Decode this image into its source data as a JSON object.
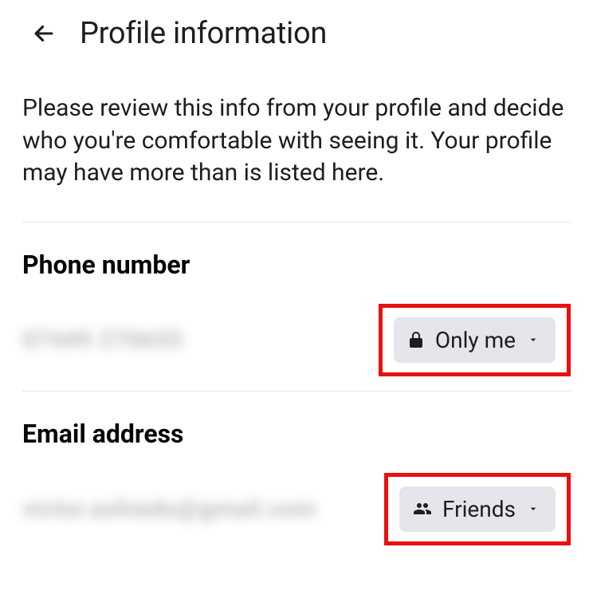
{
  "header": {
    "title": "Profile information"
  },
  "description": "Please review this info from your profile and decide who you're comfortable with seeing it. Your profile may have more than is listed here.",
  "sections": {
    "phone": {
      "title": "Phone number",
      "value": "07449 270655",
      "audience": "Only me"
    },
    "email": {
      "title": "Email address",
      "value": "victor.ashiedu@gmail.com",
      "audience": "Friends"
    }
  }
}
